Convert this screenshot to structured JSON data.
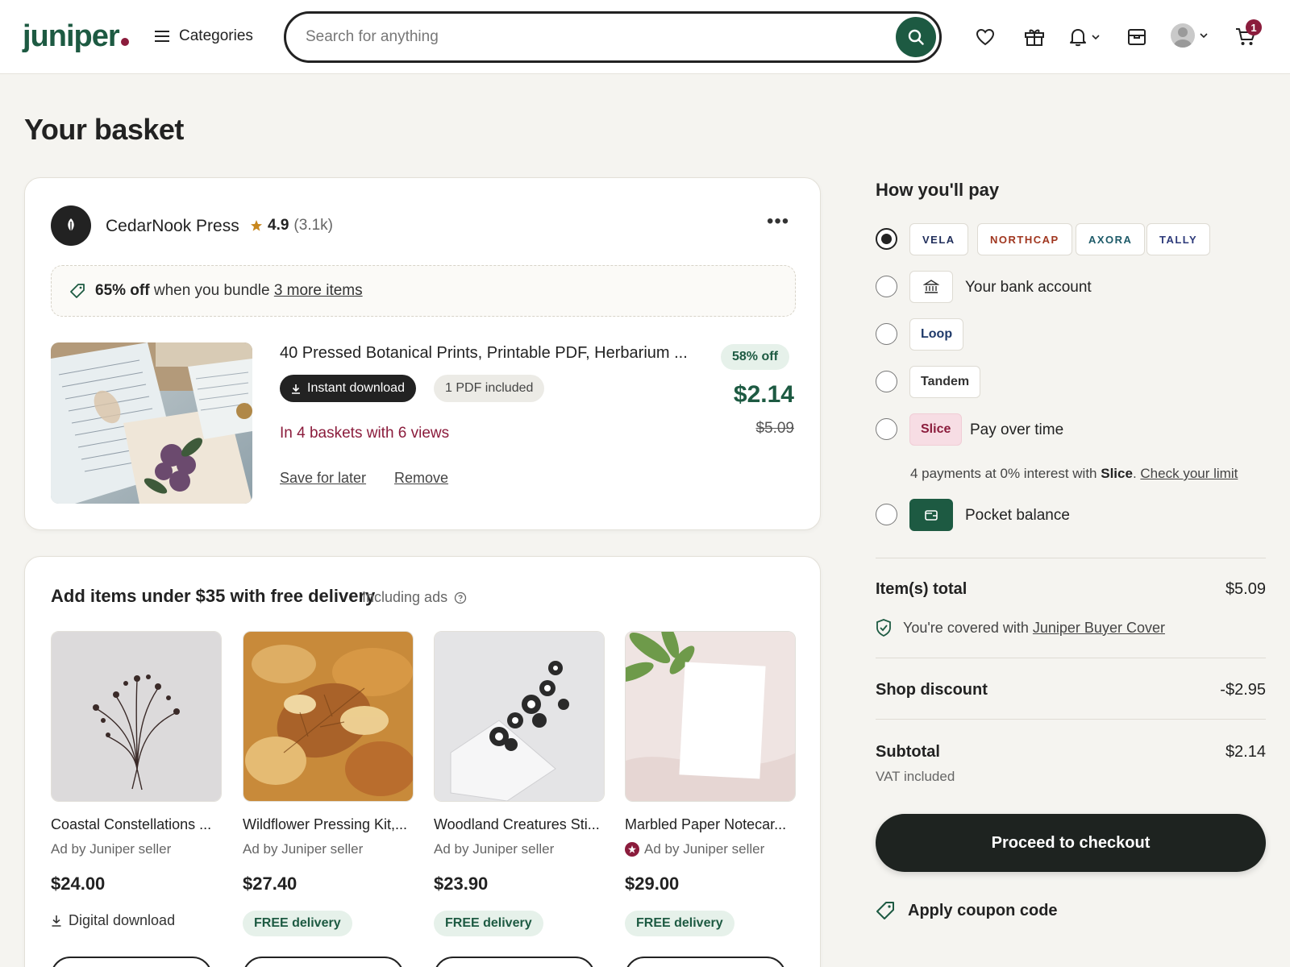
{
  "header": {
    "logo": "juniper",
    "categories_label": "Categories",
    "search_placeholder": "Search for anything",
    "cart_count": "1",
    "icons": [
      "heart-icon",
      "gift-icon",
      "bell-icon",
      "shop-icon",
      "avatar",
      "cart-icon"
    ]
  },
  "page_title": "Your basket",
  "shop": {
    "name": "CedarNook Press",
    "rating": "4.9",
    "reviews": "(3.1k)",
    "bundle": {
      "bold": "65% off",
      "text": "when you bundle",
      "link": "3 more items"
    },
    "item": {
      "title": "40 Pressed Botanical Prints, Printable PDF, Herbarium ...",
      "tag_download": "Instant download",
      "tag_pdf": "1 PDF included",
      "discount": "58% off",
      "price": "$2.14",
      "original_price": "$5.09",
      "popularity": "In 4 baskets with 6 views",
      "save_label": "Save for later",
      "remove_label": "Remove"
    }
  },
  "recommendations": {
    "title": "Add items under $35 with free delivery",
    "subtitle": "Including ads",
    "items": [
      {
        "name": "Coastal Constellations ...",
        "ad": "Ad by Juniper seller",
        "price": "$24.00",
        "badge": "Digital download"
      },
      {
        "name": "Wildflower Pressing Kit,...",
        "ad": "Ad by Juniper seller",
        "price": "$27.40",
        "badge": "FREE delivery"
      },
      {
        "name": "Woodland Creatures Sti...",
        "ad": "Ad by Juniper seller",
        "price": "$23.90",
        "badge": "FREE delivery"
      },
      {
        "name": "Marbled Paper Notecar...",
        "ad": "Ad by Juniper seller",
        "price": "$29.00",
        "badge": "FREE delivery"
      }
    ]
  },
  "payment": {
    "title": "How you'll pay",
    "brands": [
      "VELA",
      "NORTHCAP",
      "AXORA",
      "TALLY"
    ],
    "brand_colors": {
      "VELA": "#1f2d5a",
      "NORTHCAP": "#a0361f",
      "AXORA": "#1d5a68",
      "TALLY": "#2d3a7a"
    },
    "bank_label": "Your bank account",
    "loop_label": "Loop",
    "tandem_label": "Tandem",
    "slice_label": "Slice",
    "slice_text": "Pay over time",
    "slice_note_pre": "4 payments at 0% interest with",
    "slice_note_brand": "Slice",
    "slice_note_link": "Check your limit",
    "pocket_label": "Pocket balance"
  },
  "summary": {
    "items_total_label": "Item(s) total",
    "items_total_value": "$5.09",
    "covered_text": "You're covered with",
    "covered_link": "Juniper Buyer Cover",
    "discount_label": "Shop discount",
    "discount_value": "-$2.95",
    "subtotal_label": "Subtotal",
    "subtotal_value": "$2.14",
    "vat_label": "VAT included",
    "checkout_label": "Proceed to checkout",
    "coupon_label": "Apply coupon code"
  },
  "colors": {
    "brand_green": "#1d5a42",
    "accent_maroon": "#8b1c3c",
    "background": "#f5f4f0"
  }
}
